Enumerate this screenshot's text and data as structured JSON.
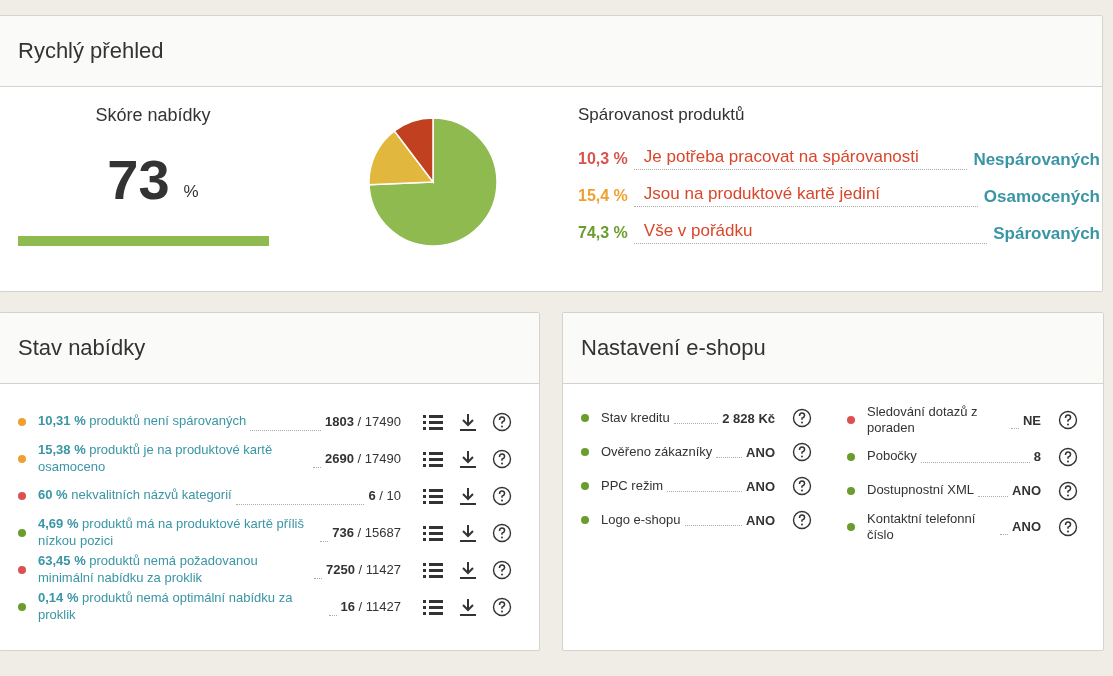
{
  "overview": {
    "title": "Rychlý přehled",
    "score": {
      "label": "Skóre nabídky",
      "value": "73",
      "unit": "%"
    },
    "chart_data": {
      "type": "pie",
      "values": [
        74.3,
        15.4,
        10.3
      ],
      "colors": [
        "#8fba4f",
        "#e2b73e",
        "#c0401f"
      ]
    },
    "pairing": {
      "title": "Spárovanost produktů",
      "rows": [
        {
          "percent": "10,3 %",
          "color": "#d9534f",
          "note": "Je potřeba pracovat na spárovanosti",
          "label": "Nespárovaných"
        },
        {
          "percent": "15,4 %",
          "color": "#f0a030",
          "note": "Jsou na produktové kartě jediní",
          "label": "Osamocených"
        },
        {
          "percent": "74,3 %",
          "color": "#6a9e2c",
          "note": "Vše v pořádku",
          "label": "Spárovaných"
        }
      ]
    }
  },
  "offer_status": {
    "title": "Stav nabídky",
    "rows": [
      {
        "color": "#f0a030",
        "text": "**10,31 %** produktů není spárovaných",
        "count": "**1803** / 17490"
      },
      {
        "color": "#f0a030",
        "text": "**15,38 %** produktů je na produktové kartě osamoceno",
        "count": "**2690** / 17490"
      },
      {
        "color": "#dc5050",
        "text": "**60 %** nekvalitních názvů kategorií",
        "count": "**6** / 10"
      },
      {
        "color": "#6a9e2c",
        "text": "**4,69 %** produktů má na produktové kartě příliš nízkou pozici",
        "count": "**736** / 15687"
      },
      {
        "color": "#dc5050",
        "text": "**63,45 %** produktů nemá požadovanou minimální nabídku za proklik",
        "count": "**7250** / 11427"
      },
      {
        "color": "#6a9e2c",
        "text": "**0,14 %** produktů nemá optimální nabídku za proklik",
        "count": "**16** / 11427"
      }
    ]
  },
  "shop_settings": {
    "title": "Nastavení e-shopu",
    "columns": [
      [
        {
          "color": "#6a9e2c",
          "label": "Stav kreditu",
          "value": "2 828 Kč"
        },
        {
          "color": "#6a9e2c",
          "label": "Ověřeno zákazníky",
          "value": "ANO"
        },
        {
          "color": "#6a9e2c",
          "label": "PPC režim",
          "value": "ANO"
        },
        {
          "color": "#6a9e2c",
          "label": "Logo e-shopu",
          "value": "ANO"
        }
      ],
      [
        {
          "color": "#dc5050",
          "label": "Sledování dotazů z poraden",
          "value": "NE"
        },
        {
          "color": "#6a9e2c",
          "label": "Pobočky",
          "value": "8"
        },
        {
          "color": "#6a9e2c",
          "label": "Dostupnostní XML",
          "value": "ANO"
        },
        {
          "color": "#6a9e2c",
          "label": "Kontaktní telefonní číslo",
          "value": "ANO"
        }
      ]
    ]
  }
}
